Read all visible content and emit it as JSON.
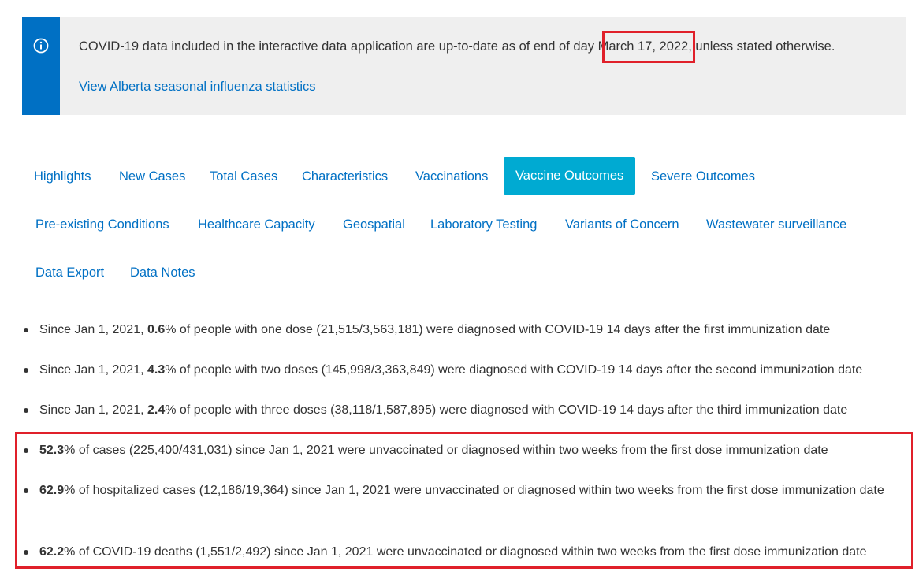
{
  "notice": {
    "text_before_date": "COVID-19 data included in the interactive data application are up-to-date as of end of day ",
    "date": "March 17, 2022",
    "text_after_date": ", unless stated otherwise.",
    "link_label": "View Alberta seasonal influenza statistics",
    "icon": "info-icon",
    "accent_color": "#0070c4"
  },
  "tabs": {
    "row1": [
      {
        "label": "Highlights"
      },
      {
        "label": "New Cases"
      },
      {
        "label": "Total Cases"
      },
      {
        "label": "Characteristics"
      },
      {
        "label": "Vaccinations"
      },
      {
        "label": "Vaccine Outcomes",
        "active": true
      },
      {
        "label": "Severe Outcomes"
      }
    ],
    "row2": [
      {
        "label": "Pre-existing Conditions"
      },
      {
        "label": "Healthcare Capacity"
      },
      {
        "label": "Geospatial"
      },
      {
        "label": "Laboratory Testing"
      },
      {
        "label": "Variants of Concern"
      },
      {
        "label": "Wastewater surveillance"
      }
    ],
    "row3": [
      {
        "label": "Data Export"
      },
      {
        "label": "Data Notes"
      }
    ],
    "active_color": "#00aad2"
  },
  "outcomes": [
    {
      "prefix": "Since Jan 1, 2021, ",
      "value": "0.6",
      "suffix": "% of people with one dose (21,515/3,563,181) were diagnosed with COVID-19 14 days after the first immunization date"
    },
    {
      "prefix": "Since Jan 1, 2021, ",
      "value": "4.3",
      "suffix": "% of people with two doses (145,998/3,363,849) were diagnosed with COVID-19 14 days after the second immunization date"
    },
    {
      "prefix": "Since Jan 1, 2021, ",
      "value": "2.4",
      "suffix": "% of people with three doses (38,118/1,587,895) were diagnosed with COVID-19 14 days after the third immunization date"
    },
    {
      "prefix": "",
      "value": "52.3",
      "suffix": "% of cases (225,400/431,031) since Jan 1, 2021 were unvaccinated or diagnosed within two weeks from the first dose immunization date"
    },
    {
      "prefix": "",
      "value": "62.9",
      "suffix": "% of hospitalized cases (12,186/19,364) since Jan 1, 2021 were unvaccinated or diagnosed within two weeks from the first dose immunization date"
    },
    {
      "prefix": "",
      "value": "62.2",
      "suffix": "% of COVID-19 deaths (1,551/2,492) since Jan 1, 2021 were unvaccinated or diagnosed within two weeks from the first dose immunization date"
    }
  ],
  "annotation_color": "#e0202a"
}
